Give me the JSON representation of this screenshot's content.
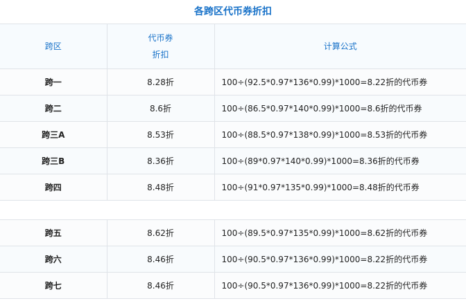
{
  "title": "各跨区代币券折扣",
  "headers": {
    "region": "跨区",
    "discount_line1": "代币券",
    "discount_line2": "折扣",
    "formula": "计算公式"
  },
  "group1": [
    {
      "region": "跨一",
      "discount": "8.28折",
      "formula": "100÷(92.5*0.97*136*0.99)*1000=8.22折的代币券"
    },
    {
      "region": "跨二",
      "discount": "8.6折",
      "formula": "100÷(86.5*0.97*140*0.99)*1000=8.6折的代币券"
    },
    {
      "region": "跨三A",
      "discount": "8.53折",
      "formula": "100÷(88.5*0.97*138*0.99)*1000=8.53折的代币券"
    },
    {
      "region": "跨三B",
      "discount": "8.36折",
      "formula": "100÷(89*0.97*140*0.99)*1000=8.36折的代币券"
    },
    {
      "region": "跨四",
      "discount": "8.48折",
      "formula": "100÷(91*0.97*135*0.99)*1000=8.48折的代币券"
    }
  ],
  "group2": [
    {
      "region": "跨五",
      "discount": "8.62折",
      "formula": "100÷(89.5*0.97*135*0.99)*1000=8.62折的代币券"
    },
    {
      "region": "跨六",
      "discount": "8.46折",
      "formula": "100÷(90.5*0.97*136*0.99)*1000=8.22折的代币券"
    },
    {
      "region": "跨七",
      "discount": "8.46折",
      "formula": "100÷(90.5*0.97*136*0.99)*1000=8.22折的代币券"
    }
  ]
}
